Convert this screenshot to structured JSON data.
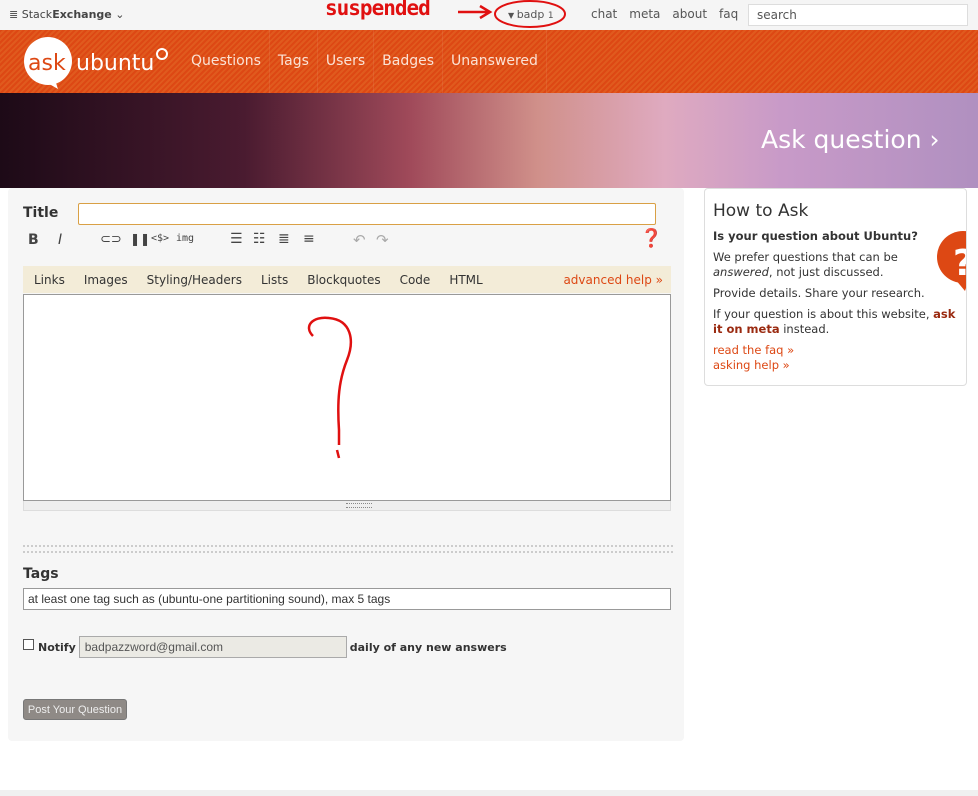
{
  "topbar": {
    "stackexchange_prefix": "Stack",
    "stackexchange_bold": "Exchange",
    "user": "badp",
    "rep": "1",
    "links": [
      "chat",
      "meta",
      "about",
      "faq"
    ],
    "search_placeholder": "search"
  },
  "annotation": {
    "text": "suspended",
    "color": "#e01010"
  },
  "header": {
    "logo_ask": "ask",
    "logo_ubuntu": "ubuntu",
    "nav": [
      "Questions",
      "Tags",
      "Users",
      "Badges",
      "Unanswered"
    ],
    "accent": "#dd4814"
  },
  "banner": {
    "ask_question": "Ask question ›"
  },
  "form": {
    "title_label": "Title",
    "title_value": "",
    "toolbar": {
      "bold": "B",
      "italic": "I",
      "code": "<$>",
      "img": "img"
    },
    "help_tabs": [
      "Links",
      "Images",
      "Styling/Headers",
      "Lists",
      "Blockquotes",
      "Code",
      "HTML"
    ],
    "advanced_help": "advanced help »",
    "tags_label": "Tags",
    "tags_placeholder": "at least one tag such as (ubuntu-one partitioning sound), max 5 tags",
    "notify_label": "Notify",
    "email": "badpazzword@gmail.com",
    "notify_suffix": "daily of any new answers",
    "post_button": "Post Your Question"
  },
  "sidebar": {
    "title": "How to Ask",
    "q": "Is your question about Ubuntu?",
    "p1a": "We prefer questions that can be ",
    "p1em": "answered",
    "p1b": ", not just discussed.",
    "p2": "Provide details. Share your research.",
    "p3a": "If your question is about this website, ",
    "p3link": "ask it on meta",
    "p3b": " instead.",
    "faq": "read the faq »",
    "help": "asking help »"
  }
}
